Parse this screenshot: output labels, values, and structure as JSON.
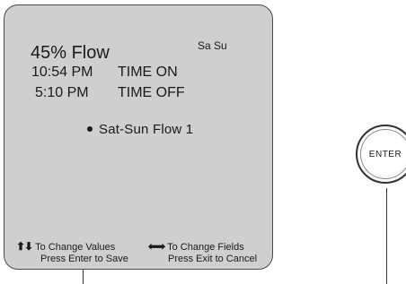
{
  "display": {
    "flow": "45% Flow",
    "days": "Sa Su",
    "time_on": {
      "value": "10:54 PM",
      "label": "TIME ON"
    },
    "time_off": {
      "value": "5:10 PM",
      "label": "TIME OFF"
    },
    "program": "Sat-Sun Flow 1"
  },
  "hints": {
    "values": "To Change Values",
    "save": "Press Enter to Save",
    "fields": "To Change Fields",
    "cancel": "Press Exit to Cancel"
  },
  "button": {
    "label": "ENTER"
  },
  "icons": {
    "updown": "up-down-arrows-icon",
    "leftright": "left-right-arrows-icon",
    "bullet": "bullet-icon"
  }
}
